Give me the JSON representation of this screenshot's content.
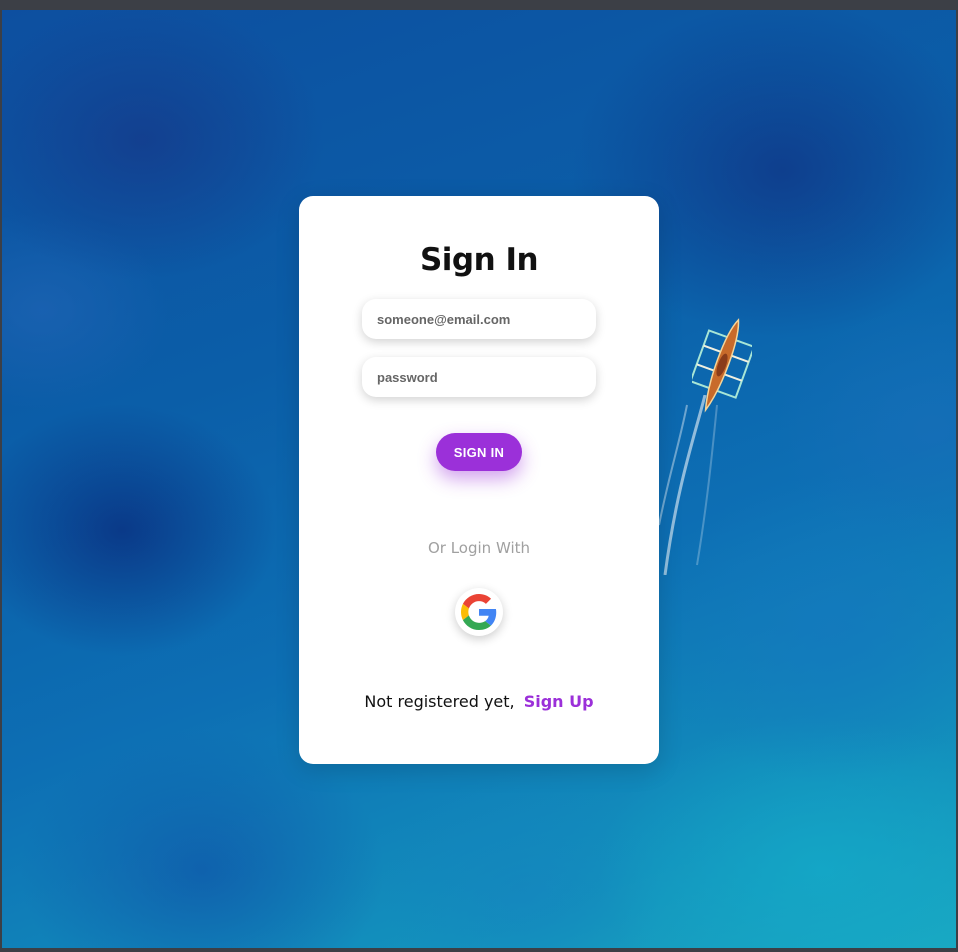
{
  "form": {
    "title": "Sign In",
    "email_placeholder": "someone@email.com",
    "password_placeholder": "password",
    "submit_label": "SIGN IN",
    "alt_login_text": "Or Login With",
    "register_prompt": "Not registered yet,",
    "signup_label": "Sign Up"
  },
  "icons": {
    "google": "google-icon"
  },
  "colors": {
    "accent": "#9b30d9",
    "card_bg": "#ffffff",
    "placeholder": "#666666",
    "muted_text": "#a0a0a0"
  }
}
